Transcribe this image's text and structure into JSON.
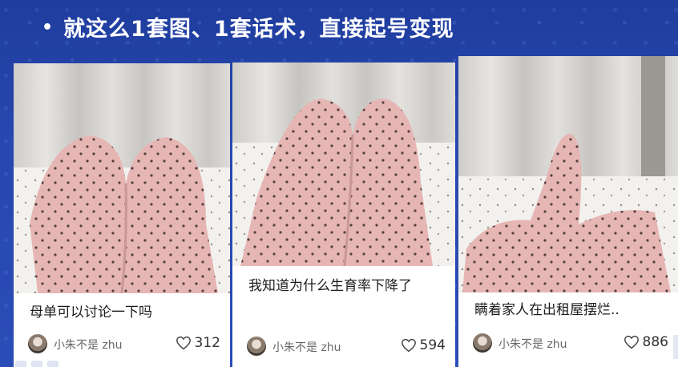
{
  "slide": {
    "headline": "就这么1套图、1套话术，直接起号变现"
  },
  "cards": [
    {
      "caption": "母单可以讨论一下吗",
      "author": "小朱不是 zhu",
      "likes": "312"
    },
    {
      "caption": "我知道为什么生育率下降了",
      "author": "小朱不是 zhu",
      "likes": "594"
    },
    {
      "caption": "瞒着家人在出租屋摆烂..",
      "author": "小朱不是 zhu",
      "likes": "886"
    }
  ],
  "icons": [
    "heart-icon",
    "avatar"
  ],
  "colors": {
    "background": "#2748b0",
    "card": "#ffffff",
    "pants": "#e3b4b4"
  }
}
